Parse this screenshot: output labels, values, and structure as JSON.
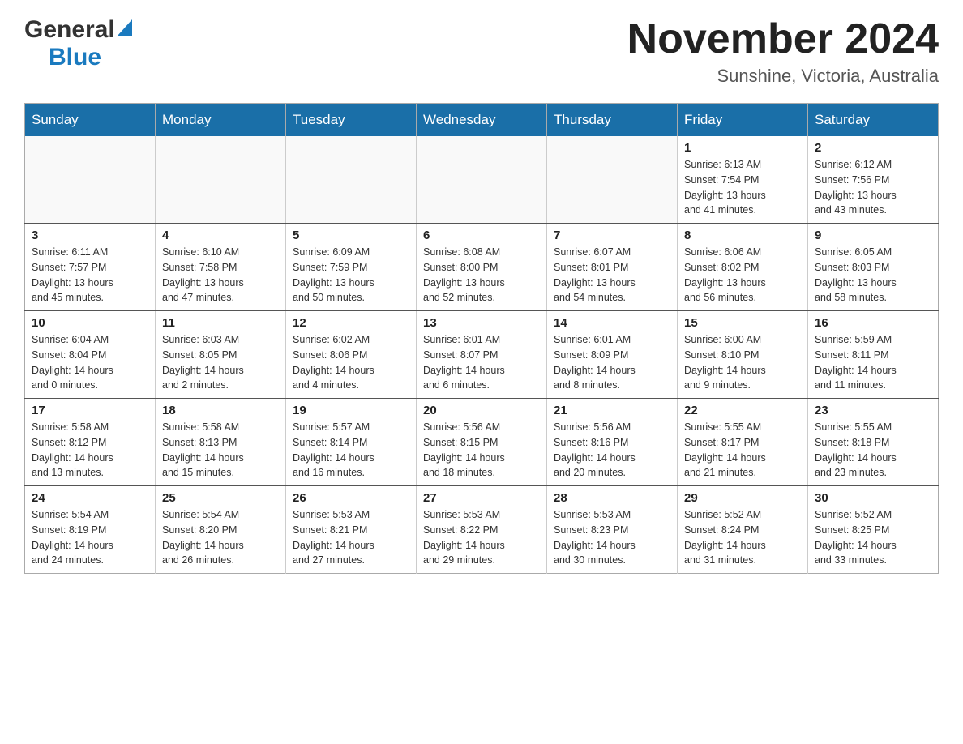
{
  "header": {
    "logo_general": "General",
    "logo_blue": "Blue",
    "month_title": "November 2024",
    "location": "Sunshine, Victoria, Australia"
  },
  "days_of_week": [
    "Sunday",
    "Monday",
    "Tuesday",
    "Wednesday",
    "Thursday",
    "Friday",
    "Saturday"
  ],
  "weeks": [
    [
      {
        "day": "",
        "info": ""
      },
      {
        "day": "",
        "info": ""
      },
      {
        "day": "",
        "info": ""
      },
      {
        "day": "",
        "info": ""
      },
      {
        "day": "",
        "info": ""
      },
      {
        "day": "1",
        "info": "Sunrise: 6:13 AM\nSunset: 7:54 PM\nDaylight: 13 hours\nand 41 minutes."
      },
      {
        "day": "2",
        "info": "Sunrise: 6:12 AM\nSunset: 7:56 PM\nDaylight: 13 hours\nand 43 minutes."
      }
    ],
    [
      {
        "day": "3",
        "info": "Sunrise: 6:11 AM\nSunset: 7:57 PM\nDaylight: 13 hours\nand 45 minutes."
      },
      {
        "day": "4",
        "info": "Sunrise: 6:10 AM\nSunset: 7:58 PM\nDaylight: 13 hours\nand 47 minutes."
      },
      {
        "day": "5",
        "info": "Sunrise: 6:09 AM\nSunset: 7:59 PM\nDaylight: 13 hours\nand 50 minutes."
      },
      {
        "day": "6",
        "info": "Sunrise: 6:08 AM\nSunset: 8:00 PM\nDaylight: 13 hours\nand 52 minutes."
      },
      {
        "day": "7",
        "info": "Sunrise: 6:07 AM\nSunset: 8:01 PM\nDaylight: 13 hours\nand 54 minutes."
      },
      {
        "day": "8",
        "info": "Sunrise: 6:06 AM\nSunset: 8:02 PM\nDaylight: 13 hours\nand 56 minutes."
      },
      {
        "day": "9",
        "info": "Sunrise: 6:05 AM\nSunset: 8:03 PM\nDaylight: 13 hours\nand 58 minutes."
      }
    ],
    [
      {
        "day": "10",
        "info": "Sunrise: 6:04 AM\nSunset: 8:04 PM\nDaylight: 14 hours\nand 0 minutes."
      },
      {
        "day": "11",
        "info": "Sunrise: 6:03 AM\nSunset: 8:05 PM\nDaylight: 14 hours\nand 2 minutes."
      },
      {
        "day": "12",
        "info": "Sunrise: 6:02 AM\nSunset: 8:06 PM\nDaylight: 14 hours\nand 4 minutes."
      },
      {
        "day": "13",
        "info": "Sunrise: 6:01 AM\nSunset: 8:07 PM\nDaylight: 14 hours\nand 6 minutes."
      },
      {
        "day": "14",
        "info": "Sunrise: 6:01 AM\nSunset: 8:09 PM\nDaylight: 14 hours\nand 8 minutes."
      },
      {
        "day": "15",
        "info": "Sunrise: 6:00 AM\nSunset: 8:10 PM\nDaylight: 14 hours\nand 9 minutes."
      },
      {
        "day": "16",
        "info": "Sunrise: 5:59 AM\nSunset: 8:11 PM\nDaylight: 14 hours\nand 11 minutes."
      }
    ],
    [
      {
        "day": "17",
        "info": "Sunrise: 5:58 AM\nSunset: 8:12 PM\nDaylight: 14 hours\nand 13 minutes."
      },
      {
        "day": "18",
        "info": "Sunrise: 5:58 AM\nSunset: 8:13 PM\nDaylight: 14 hours\nand 15 minutes."
      },
      {
        "day": "19",
        "info": "Sunrise: 5:57 AM\nSunset: 8:14 PM\nDaylight: 14 hours\nand 16 minutes."
      },
      {
        "day": "20",
        "info": "Sunrise: 5:56 AM\nSunset: 8:15 PM\nDaylight: 14 hours\nand 18 minutes."
      },
      {
        "day": "21",
        "info": "Sunrise: 5:56 AM\nSunset: 8:16 PM\nDaylight: 14 hours\nand 20 minutes."
      },
      {
        "day": "22",
        "info": "Sunrise: 5:55 AM\nSunset: 8:17 PM\nDaylight: 14 hours\nand 21 minutes."
      },
      {
        "day": "23",
        "info": "Sunrise: 5:55 AM\nSunset: 8:18 PM\nDaylight: 14 hours\nand 23 minutes."
      }
    ],
    [
      {
        "day": "24",
        "info": "Sunrise: 5:54 AM\nSunset: 8:19 PM\nDaylight: 14 hours\nand 24 minutes."
      },
      {
        "day": "25",
        "info": "Sunrise: 5:54 AM\nSunset: 8:20 PM\nDaylight: 14 hours\nand 26 minutes."
      },
      {
        "day": "26",
        "info": "Sunrise: 5:53 AM\nSunset: 8:21 PM\nDaylight: 14 hours\nand 27 minutes."
      },
      {
        "day": "27",
        "info": "Sunrise: 5:53 AM\nSunset: 8:22 PM\nDaylight: 14 hours\nand 29 minutes."
      },
      {
        "day": "28",
        "info": "Sunrise: 5:53 AM\nSunset: 8:23 PM\nDaylight: 14 hours\nand 30 minutes."
      },
      {
        "day": "29",
        "info": "Sunrise: 5:52 AM\nSunset: 8:24 PM\nDaylight: 14 hours\nand 31 minutes."
      },
      {
        "day": "30",
        "info": "Sunrise: 5:52 AM\nSunset: 8:25 PM\nDaylight: 14 hours\nand 33 minutes."
      }
    ]
  ]
}
